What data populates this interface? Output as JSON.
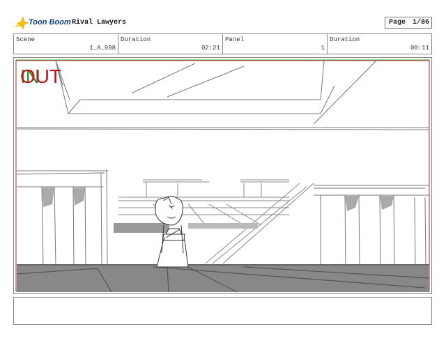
{
  "header": {
    "logo_text": "Toon Boom",
    "project_title": "Rival Lawyers",
    "page_label": "Page",
    "page_value": "1/86"
  },
  "info": {
    "scene_label": "Scene",
    "scene_value": "1_A_998",
    "duration_label": "Duration",
    "duration_value": "02:21",
    "panel_label": "Panel",
    "panel_value": "1",
    "duration2_label": "Duration",
    "duration2_value": "00:11"
  },
  "panel": {
    "in_label": "IN",
    "out_label": "OUT",
    "in_color": "#2e8b2e",
    "out_color": "#c0141c"
  },
  "notes": {
    "text": ""
  }
}
